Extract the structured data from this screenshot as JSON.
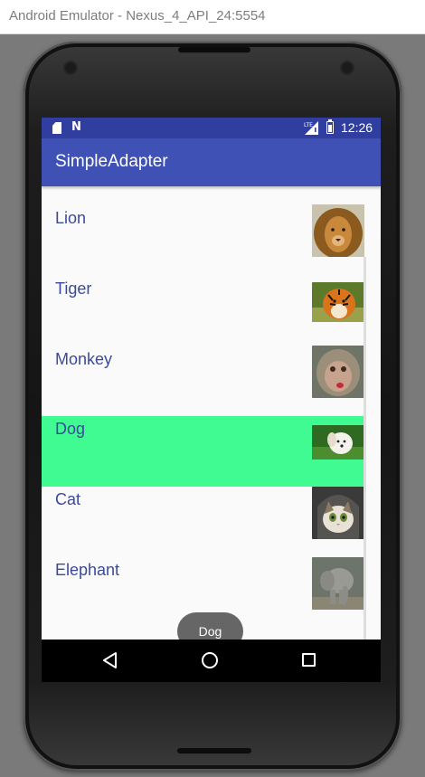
{
  "window": {
    "title": "Android Emulator - Nexus_4_API_24:5554"
  },
  "statusbar": {
    "time": "12:26",
    "icons": [
      "sd-card-icon",
      "n-notification-icon",
      "lte-signal-icon",
      "battery-icon"
    ]
  },
  "app": {
    "title": "SimpleAdapter",
    "primary_color": "#3f51b5",
    "status_color": "#303f9f"
  },
  "list": {
    "items": [
      {
        "label": "Lion",
        "image": "lion-photo"
      },
      {
        "label": "Tiger",
        "image": "tiger-photo"
      },
      {
        "label": "Monkey",
        "image": "monkey-photo"
      },
      {
        "label": "Dog",
        "image": "dog-photo",
        "selected": true
      },
      {
        "label": "Cat",
        "image": "cat-photo"
      },
      {
        "label": "Elephant",
        "image": "elephant-photo"
      }
    ],
    "selected_color": "#3ffb92",
    "label_color": "#3b4a9a"
  },
  "toast": {
    "text": "Dog"
  },
  "navbar": {
    "buttons": [
      "back-icon",
      "home-icon",
      "recents-icon"
    ]
  }
}
